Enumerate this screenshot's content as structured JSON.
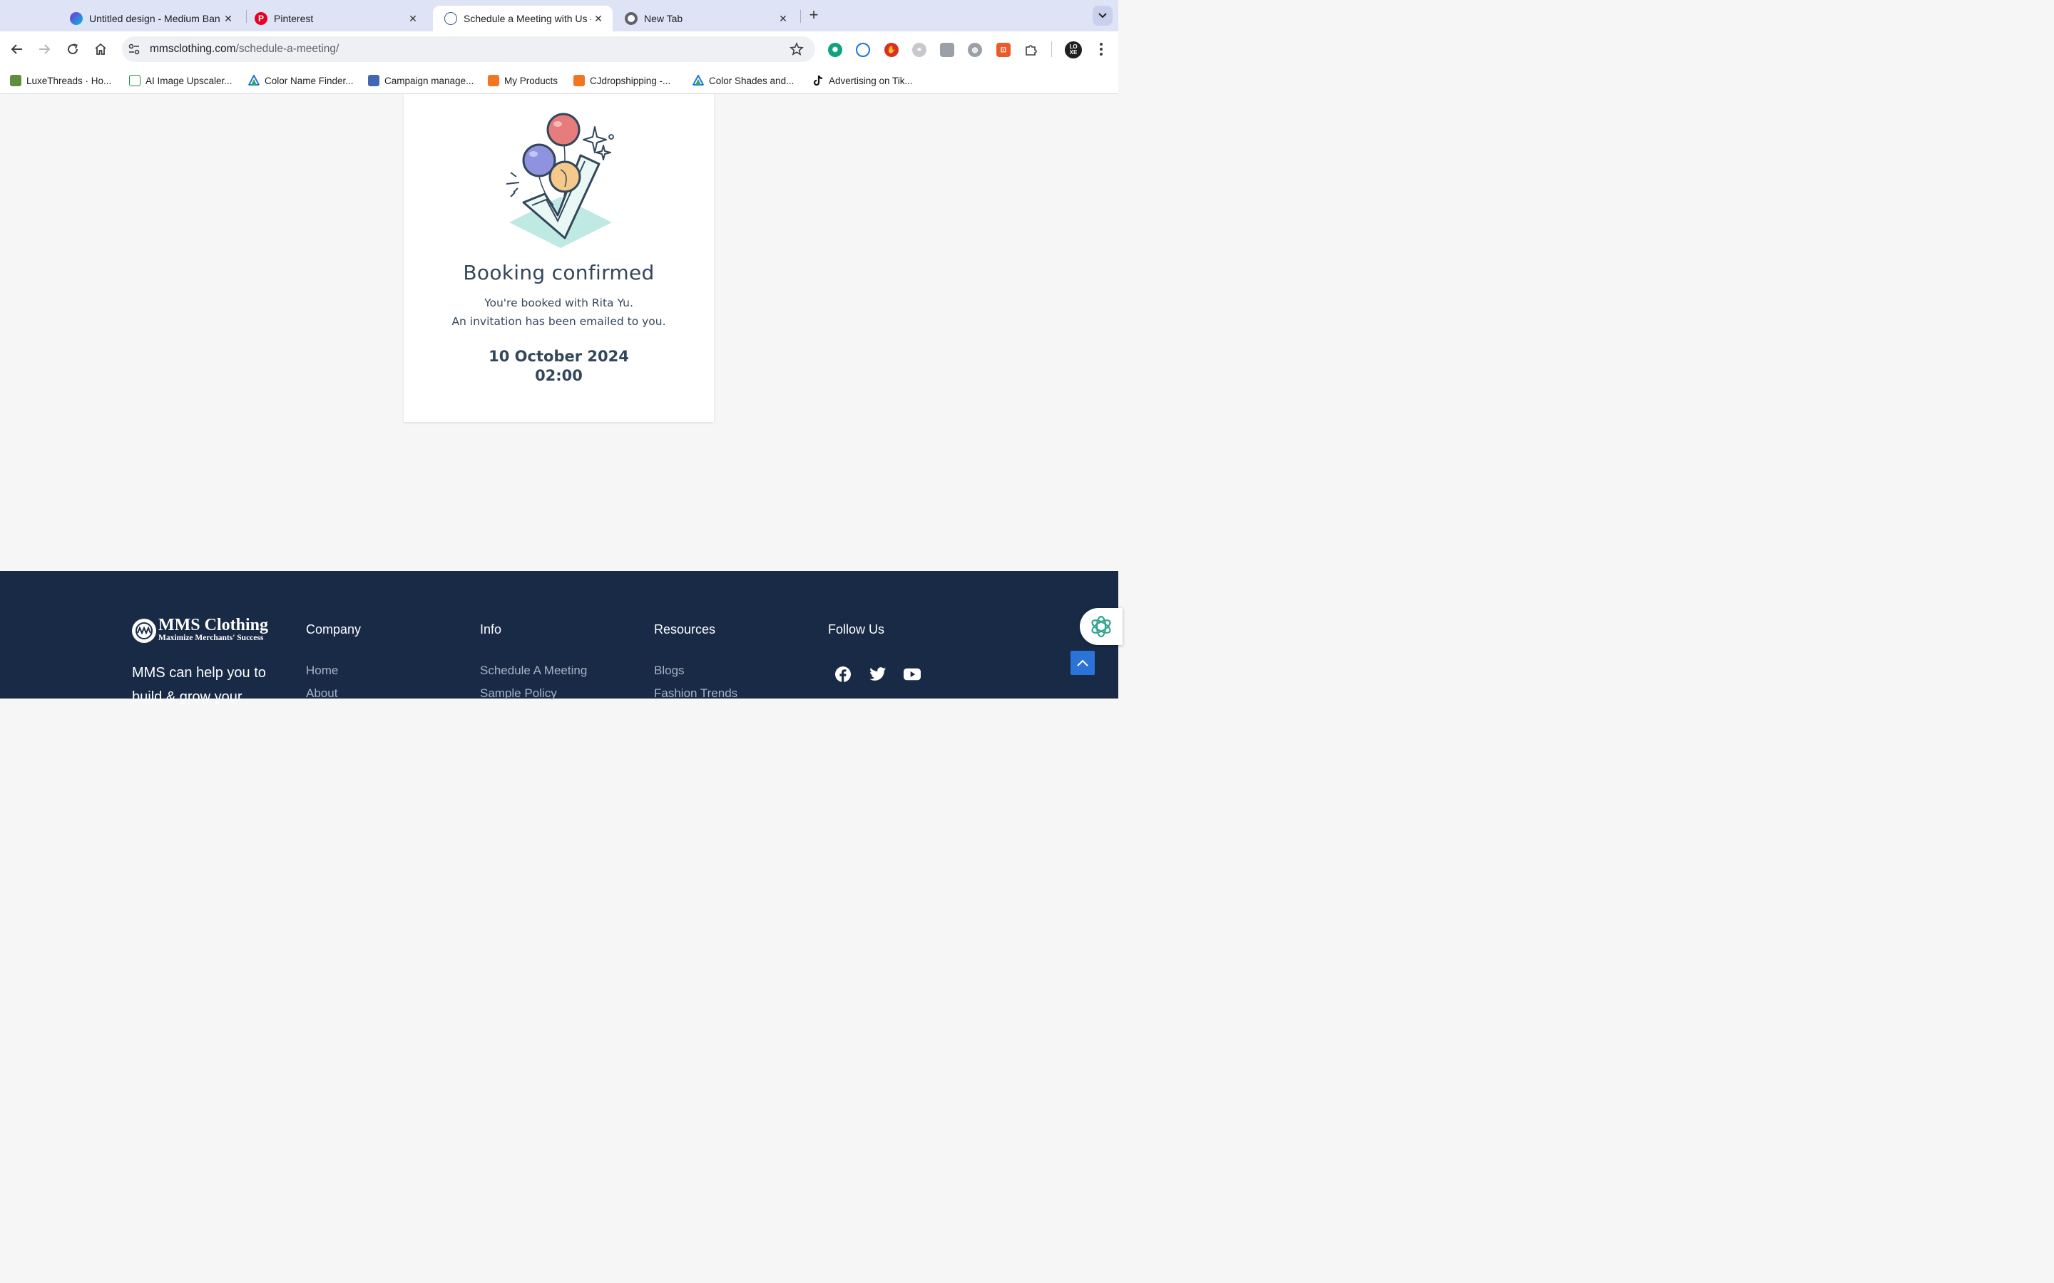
{
  "browser": {
    "tabs": [
      {
        "title": "Untitled design - Medium Ban",
        "favicon": "canva-icon"
      },
      {
        "title": "Pinterest",
        "favicon": "pinterest-icon"
      },
      {
        "title": "Schedule a Meeting with Us -",
        "favicon": "mms-clothing-icon",
        "active": true
      },
      {
        "title": "New Tab",
        "favicon": "chrome-icon"
      }
    ],
    "address": {
      "domain": "mmsclothing.com",
      "path": "/schedule-a-meeting/"
    },
    "profile_initials": "LO\nXE",
    "bookmarks": [
      {
        "label": "LuxeThreads · Ho...",
        "icon": "shopify-icon"
      },
      {
        "label": "AI Image Upscaler...",
        "icon": "image-upscaler-icon"
      },
      {
        "label": "Color Name Finder...",
        "icon": "color-finder-icon"
      },
      {
        "label": "Campaign manage...",
        "icon": "campaign-icon"
      },
      {
        "label": "My Products",
        "icon": "cj-icon"
      },
      {
        "label": "CJdropshipping -...",
        "icon": "cj-icon"
      },
      {
        "label": "Color Shades and...",
        "icon": "color-shades-icon"
      },
      {
        "label": "Advertising on Tik...",
        "icon": "tiktok-icon"
      }
    ]
  },
  "confirmation": {
    "title": "Booking confirmed",
    "line1": "You're booked with Rita Yu.",
    "line2": "An invitation has been emailed to you.",
    "date": "10 October 2024",
    "time": "02:00"
  },
  "footer": {
    "logo_name": "MMS Clothing",
    "logo_tagline": "Maximize Merchants' Success",
    "about": "MMS can help you to build & grow your",
    "columns": [
      {
        "heading": "Company",
        "links": [
          "Home",
          "About"
        ]
      },
      {
        "heading": "Info",
        "links": [
          "Schedule A Meeting",
          "Sample Policy"
        ]
      },
      {
        "heading": "Resources",
        "links": [
          "Blogs",
          "Fashion Trends"
        ]
      },
      {
        "heading": "Follow Us",
        "links": []
      }
    ],
    "social": [
      "facebook-icon",
      "twitter-icon",
      "youtube-icon"
    ]
  },
  "colors": {
    "footer_bg": "#182a46",
    "tabstrip_bg": "#dfe3f6",
    "text_dark": "#33475b",
    "back_to_top": "#2b73d8"
  }
}
